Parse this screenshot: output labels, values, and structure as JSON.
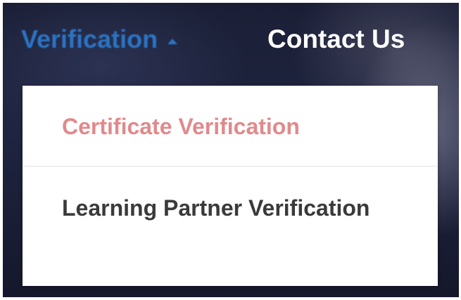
{
  "nav": {
    "verification_label": "Verification",
    "contact_label": "Contact Us",
    "caret_icon": "caret-up-icon",
    "active_color": "#2b74c4"
  },
  "dropdown": {
    "items": [
      {
        "label": "Certificate Verification",
        "color": "#e08a8c",
        "state": "hover"
      },
      {
        "label": "Learning Partner Verification",
        "color": "#3a3a3a"
      }
    ]
  }
}
